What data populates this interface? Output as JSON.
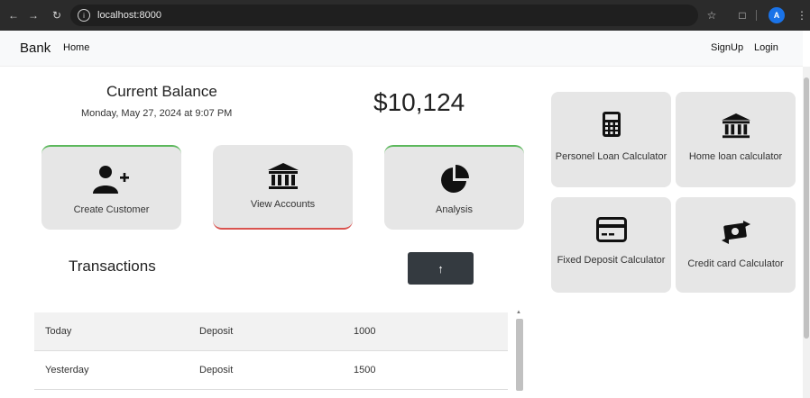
{
  "browser": {
    "url": "localhost:8000",
    "profile_initial": "A"
  },
  "nav": {
    "brand": "Bank",
    "home": "Home",
    "signup": "SignUp",
    "login": "Login"
  },
  "balance": {
    "title": "Current Balance",
    "date": "Monday, May 27, 2024 at 9:07 PM",
    "amount": "$10,124"
  },
  "actions": [
    {
      "label": "Create Customer",
      "icon": "add-user-icon"
    },
    {
      "label": "View Accounts",
      "icon": "bank-icon"
    },
    {
      "label": "Analysis",
      "icon": "pie-chart-icon"
    }
  ],
  "transactions": {
    "title": "Transactions",
    "scroll_button_icon": "arrow-up-icon",
    "rows": [
      {
        "date": "Today",
        "type": "Deposit",
        "amount": "1000"
      },
      {
        "date": "Yesterday",
        "type": "Deposit",
        "amount": "1500"
      }
    ]
  },
  "calculators": [
    {
      "label": "Personel Loan Calculator",
      "icon": "calculator-icon"
    },
    {
      "label": "Home loan calculator",
      "icon": "bank-icon"
    },
    {
      "label": "Fixed Deposit Calculator",
      "icon": "credit-card-icon"
    },
    {
      "label": "Credit card Calculator",
      "icon": "money-exchange-icon"
    }
  ]
}
